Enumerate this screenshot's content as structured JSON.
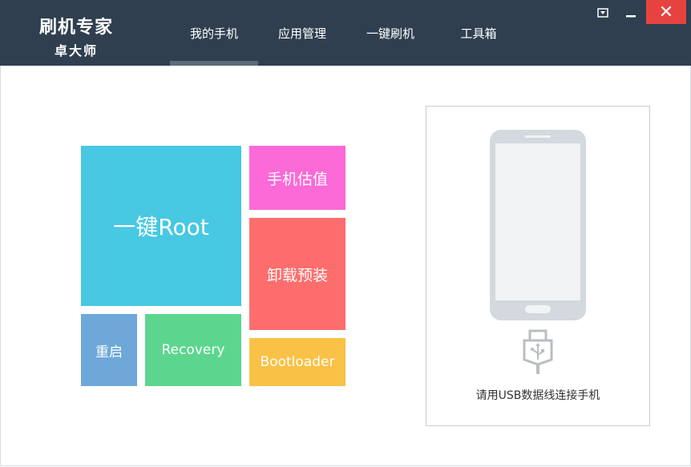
{
  "app": {
    "title": "刷机专家",
    "subtitle": "卓大师"
  },
  "nav": {
    "items": [
      {
        "label": "我的手机",
        "active": true
      },
      {
        "label": "应用管理",
        "active": false
      },
      {
        "label": "一键刷机",
        "active": false
      },
      {
        "label": "工具箱",
        "active": false
      }
    ]
  },
  "window_controls": {
    "menu_icon": "dropdown-arrow-icon",
    "min_icon": "minimize-icon",
    "close_label": "✕"
  },
  "tiles": {
    "root": {
      "label": "一键Root",
      "color": "#47c8e3"
    },
    "valuation": {
      "label": "手机估值",
      "color": "#fb6ad7"
    },
    "uninstall": {
      "label": "卸载预装",
      "color": "#fe6d6d"
    },
    "reboot": {
      "label": "重启",
      "color": "#6ea8d9"
    },
    "recovery": {
      "label": "Recovery",
      "color": "#5cd68f"
    },
    "bootloader": {
      "label": "Bootloader",
      "color": "#f9c246"
    }
  },
  "phone_panel": {
    "status_text": "请用USB数据线连接手机",
    "phone_icon": "phone-icon",
    "usb_icon": "usb-icon"
  }
}
